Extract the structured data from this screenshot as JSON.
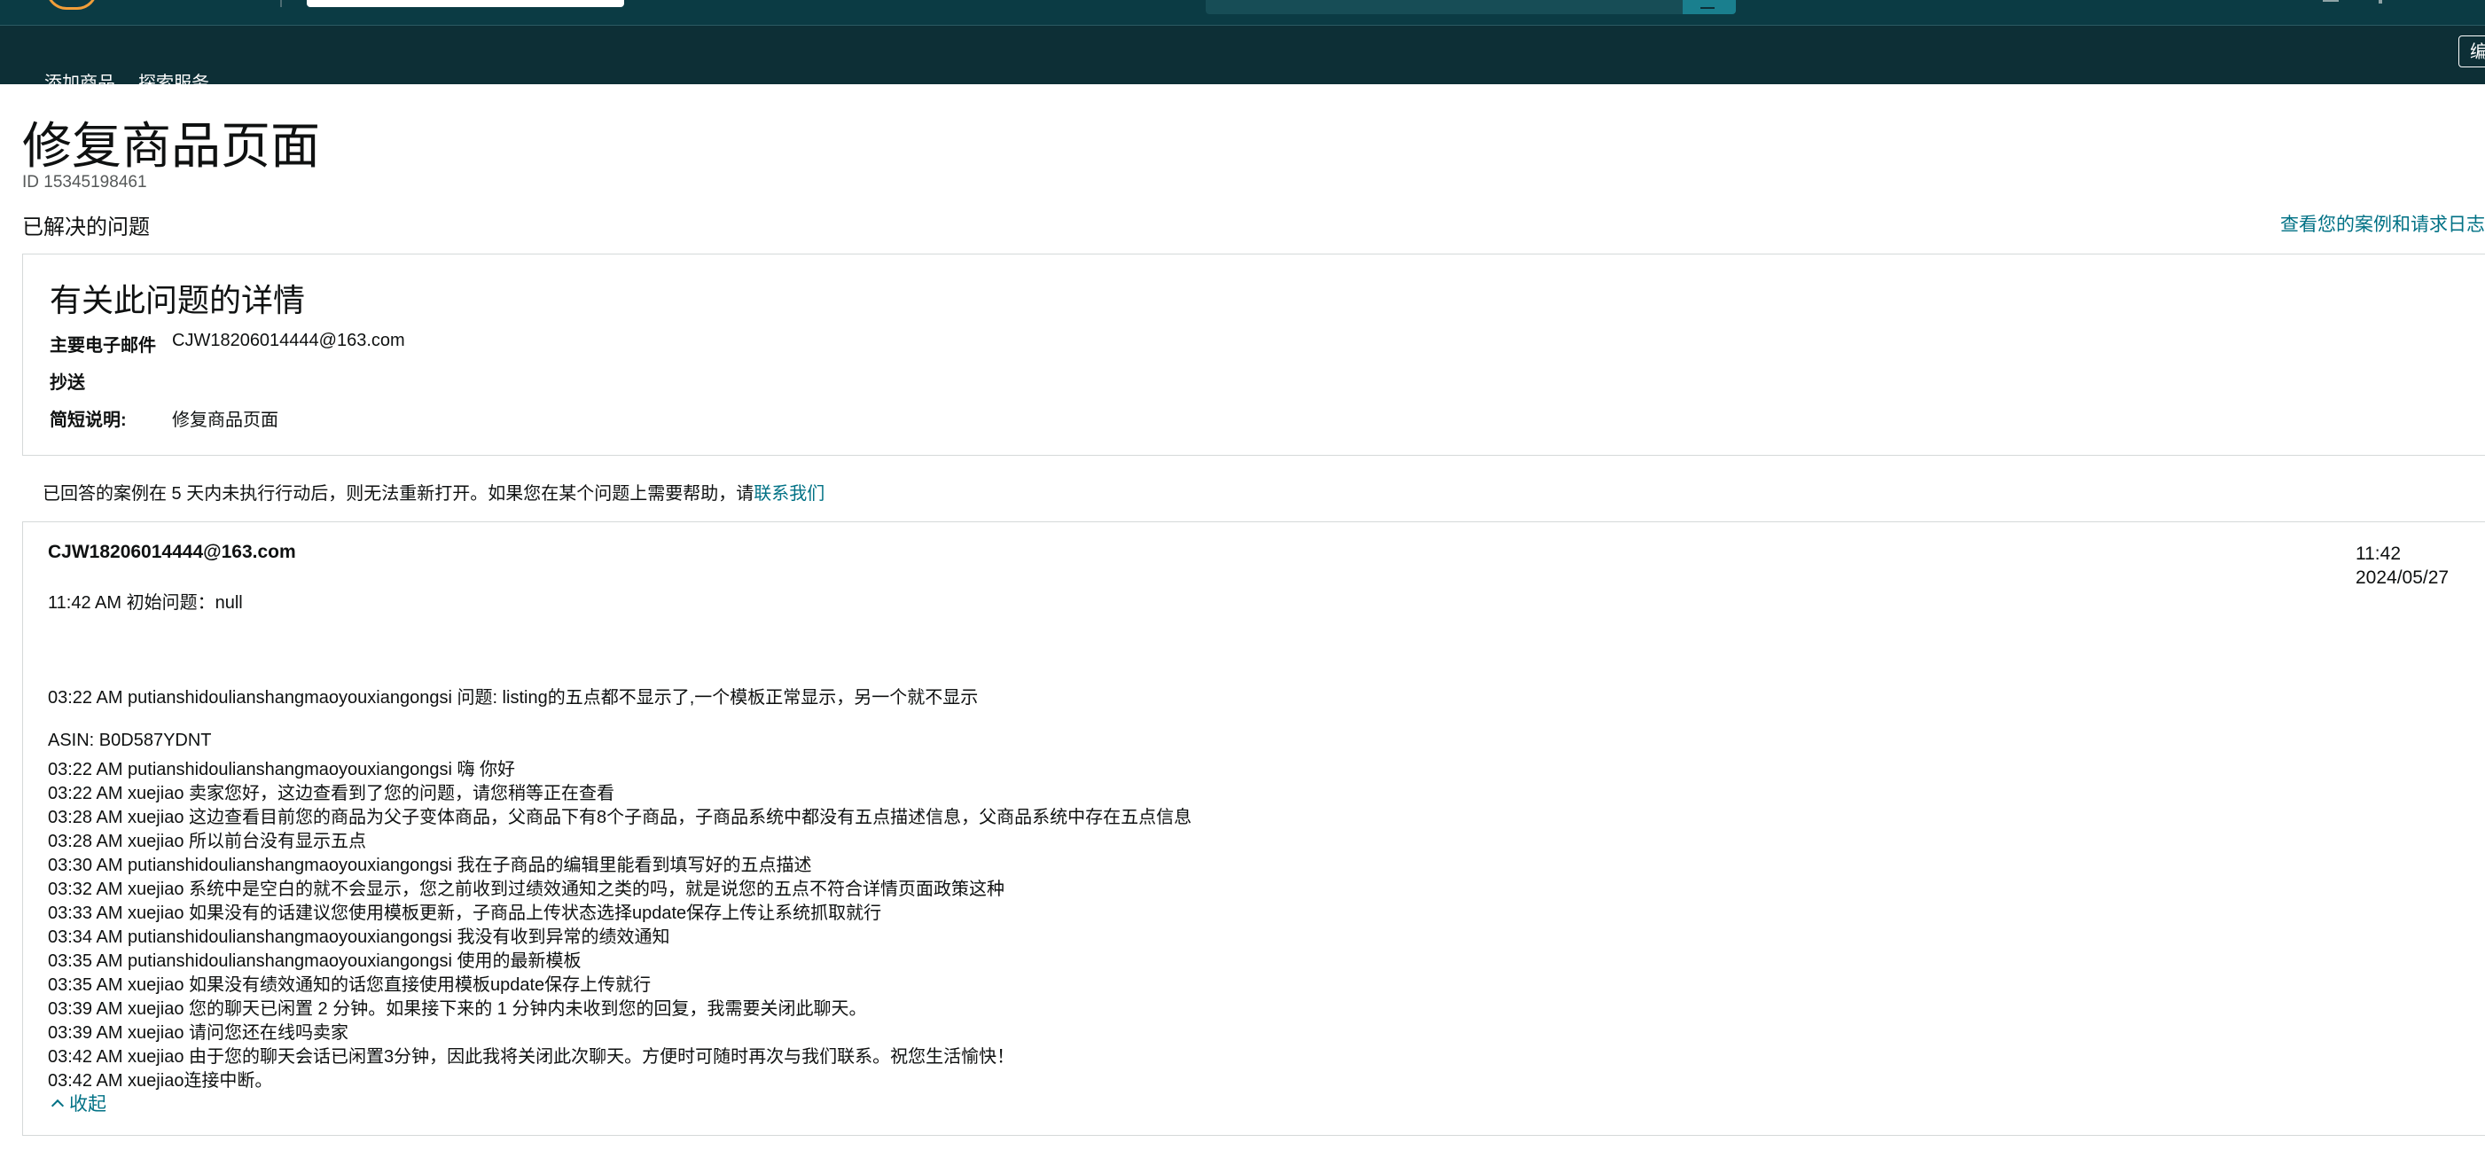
{
  "colors": {
    "header_dark": "#0d2f36",
    "header_top": "#0b3b44",
    "link": "#007185",
    "border": "#d5d9d9"
  },
  "nav": {
    "items": [
      "添加商品",
      "探索服务"
    ],
    "right_button_label": "编"
  },
  "page": {
    "title": "修复商品页面",
    "id_text": "ID 15345198461",
    "status": "已解决的问题",
    "case_log_link": "查看您的案例和请求日志"
  },
  "details": {
    "title": "有关此问题的详情",
    "primary_email_label": "主要电子邮件",
    "primary_email_value": "CJW18206014444@163.com",
    "cc_label": "抄送",
    "summary_label": "简短说明:",
    "summary_value": "修复商品页面"
  },
  "notice": {
    "text": "已回答的案例在 5 天内未执行行动后，则无法重新打开。如果您在某个问题上需要帮助，请",
    "link": "联系我们"
  },
  "conversation": {
    "sender": "CJW18206014444@163.com",
    "time": "11:42",
    "date": "2024/05/27",
    "initial": "11:42 AM 初始问题：null",
    "messages": [
      "03:22 AM putianshidoulianshangmaoyouxiangongsi 问题: listing的五点都不显示了,一个模板正常显示，另一个就不显示",
      "ASIN: B0D587YDNT",
      "03:22 AM putianshidoulianshangmaoyouxiangongsi 嗨 你好",
      "03:22 AM xuejiao 卖家您好，这边查看到了您的问题，请您稍等正在查看",
      "03:28 AM xuejiao 这边查看目前您的商品为父子变体商品，父商品下有8个子商品，子商品系统中都没有五点描述信息，父商品系统中存在五点信息",
      "03:28 AM xuejiao 所以前台没有显示五点",
      "03:30 AM putianshidoulianshangmaoyouxiangongsi 我在子商品的编辑里能看到填写好的五点描述",
      "03:32 AM xuejiao 系统中是空白的就不会显示，您之前收到过绩效通知之类的吗，就是说您的五点不符合详情页面政策这种",
      "03:33 AM xuejiao 如果没有的话建议您使用模板更新，子商品上传状态选择update保存上传让系统抓取就行",
      "03:34 AM putianshidoulianshangmaoyouxiangongsi 我没有收到异常的绩效通知",
      "03:35 AM putianshidoulianshangmaoyouxiangongsi 使用的最新模板",
      "03:35 AM xuejiao 如果没有绩效通知的话您直接使用模板update保存上传就行",
      "03:39 AM xuejiao 您的聊天已闲置 2 分钟。如果接下来的 1 分钟内未收到您的回复，我需要关闭此聊天。",
      "03:39 AM xuejiao 请问您还在线吗卖家",
      "03:42 AM xuejiao 由于您的聊天会话已闲置3分钟，因此我将关闭此次聊天。方便时可随时再次与我们联系。祝您生活愉快！",
      "03:42 AM xuejiao连接中断。"
    ],
    "collapse_label": "收起"
  }
}
